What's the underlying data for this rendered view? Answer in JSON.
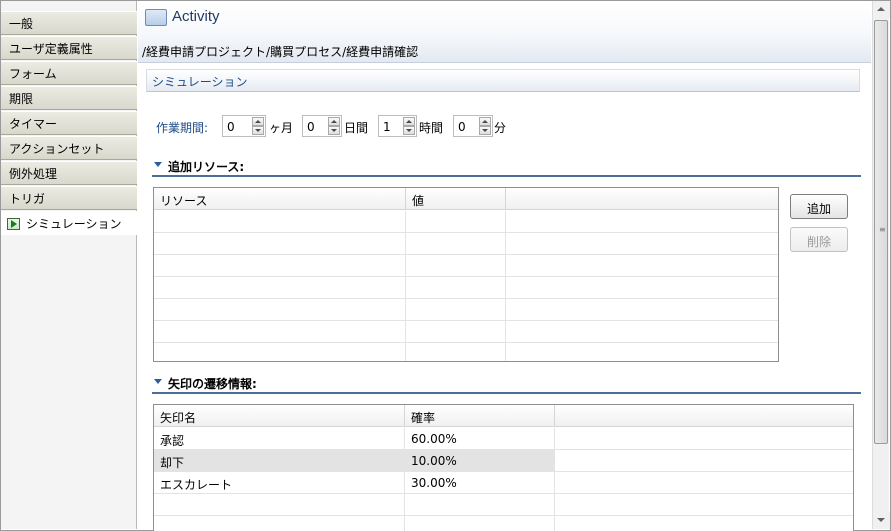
{
  "sidebar": {
    "items": [
      {
        "label": "一般"
      },
      {
        "label": "ユーザ定義属性"
      },
      {
        "label": "フォーム"
      },
      {
        "label": "期限"
      },
      {
        "label": "タイマー"
      },
      {
        "label": "アクションセット"
      },
      {
        "label": "例外処理"
      },
      {
        "label": "トリガ"
      },
      {
        "label": "シミュレーション",
        "active": true
      }
    ]
  },
  "header": {
    "title": "Activity",
    "breadcrumb": "/経費申請プロジェクト/購買プロセス/経費申請確認"
  },
  "section": {
    "title": "シミュレーション"
  },
  "duration": {
    "label": "作業期間:",
    "months": {
      "value": "0",
      "unit": "ヶ月"
    },
    "days": {
      "value": "0",
      "unit": "日間"
    },
    "hours": {
      "value": "1",
      "unit": "時間"
    },
    "minutes": {
      "value": "0",
      "unit": "分"
    }
  },
  "resources": {
    "heading": "追加リソース:",
    "columns": [
      "リソース",
      "値"
    ],
    "rows": [],
    "add_label": "追加",
    "delete_label": "削除"
  },
  "transitions": {
    "heading": "矢印の遷移情報:",
    "columns": [
      "矢印名",
      "確率"
    ],
    "rows": [
      {
        "name": "承認",
        "prob": "60.00%"
      },
      {
        "name": "却下",
        "prob": "10.00%",
        "selected": true
      },
      {
        "name": "エスカレート",
        "prob": "30.00%"
      }
    ]
  },
  "colors": {
    "accent": "#1f4c86",
    "selected_row": "#e3e3e3"
  }
}
